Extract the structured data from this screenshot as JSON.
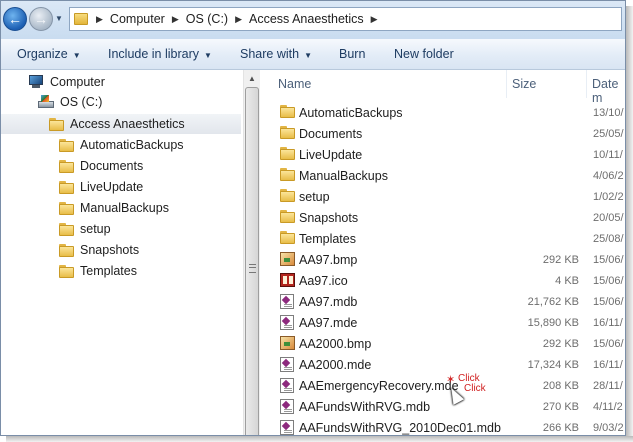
{
  "address": {
    "crumbs": [
      "Computer",
      "OS (C:)",
      "Access Anaesthetics"
    ]
  },
  "toolbar": {
    "organize": "Organize",
    "include_in_library": "Include in library",
    "share_with": "Share with",
    "burn": "Burn",
    "new_folder": "New folder"
  },
  "nav": {
    "computer": "Computer",
    "drive": "OS (C:)",
    "selected_folder": "Access Anaesthetics",
    "subfolders": [
      "AutomaticBackups",
      "Documents",
      "LiveUpdate",
      "ManualBackups",
      "setup",
      "Snapshots",
      "Templates"
    ]
  },
  "columns": {
    "name": "Name",
    "size": "Size",
    "date": "Date m"
  },
  "files": [
    {
      "name": "AutomaticBackups",
      "size": "",
      "date": "13/10/",
      "type": "folder"
    },
    {
      "name": "Documents",
      "size": "",
      "date": "25/05/",
      "type": "folder"
    },
    {
      "name": "LiveUpdate",
      "size": "",
      "date": "10/11/",
      "type": "folder"
    },
    {
      "name": "ManualBackups",
      "size": "",
      "date": "4/06/2",
      "type": "folder"
    },
    {
      "name": "setup",
      "size": "",
      "date": "1/02/2",
      "type": "folder"
    },
    {
      "name": "Snapshots",
      "size": "",
      "date": "20/05/",
      "type": "folder"
    },
    {
      "name": "Templates",
      "size": "",
      "date": "25/08/",
      "type": "folder"
    },
    {
      "name": "AA97.bmp",
      "size": "292 KB",
      "date": "15/06/",
      "type": "image"
    },
    {
      "name": "Aa97.ico",
      "size": "4 KB",
      "date": "15/06/",
      "type": "icon"
    },
    {
      "name": "AA97.mdb",
      "size": "21,762 KB",
      "date": "15/06/",
      "type": "database"
    },
    {
      "name": "AA97.mde",
      "size": "15,890 KB",
      "date": "16/11/",
      "type": "database"
    },
    {
      "name": "AA2000.bmp",
      "size": "292 KB",
      "date": "15/06/",
      "type": "image"
    },
    {
      "name": "AA2000.mde",
      "size": "17,324 KB",
      "date": "16/11/",
      "type": "database"
    },
    {
      "name": "AAEmergencyRecovery.mde",
      "size": "208 KB",
      "date": "28/11/",
      "type": "database"
    },
    {
      "name": "AAFundsWithRVG.mdb",
      "size": "270 KB",
      "date": "4/11/2",
      "type": "database"
    },
    {
      "name": "AAFundsWithRVG_2010Dec01.mdb",
      "size": "266 KB",
      "date": "9/03/2",
      "type": "database"
    }
  ],
  "annotation": {
    "line1": "Click",
    "line2": "Click"
  }
}
